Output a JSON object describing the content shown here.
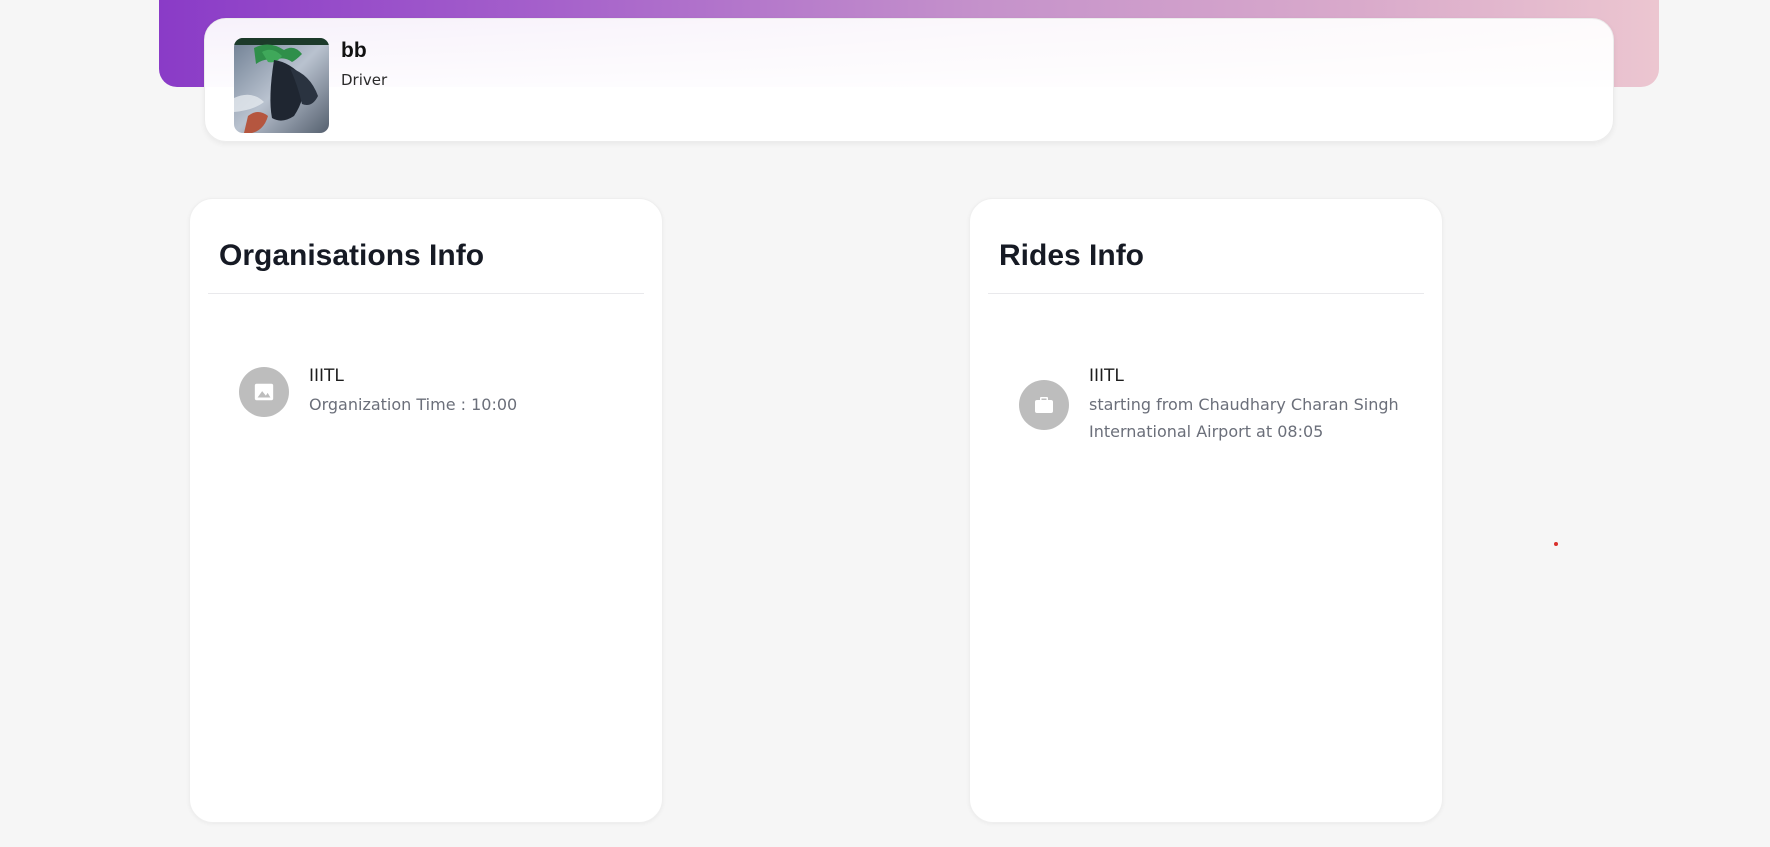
{
  "profile": {
    "name": "bb",
    "role": "Driver",
    "avatar_alt": "profile avatar"
  },
  "organisations": {
    "title": "Organisations Info",
    "items": [
      {
        "icon": "image-icon",
        "title": "IIITL",
        "subtitle": "Organization Time : 10:00"
      }
    ]
  },
  "rides": {
    "title": "Rides Info",
    "items": [
      {
        "icon": "briefcase-icon",
        "title": "IIITL",
        "subtitle": "starting from Chaudhary Charan Singh International Airport at 08:05"
      }
    ]
  },
  "colors": {
    "gradient_start": "#8a3bc7",
    "gradient_end": "#ecc6d0",
    "icon_bg": "#bdbdbd"
  }
}
